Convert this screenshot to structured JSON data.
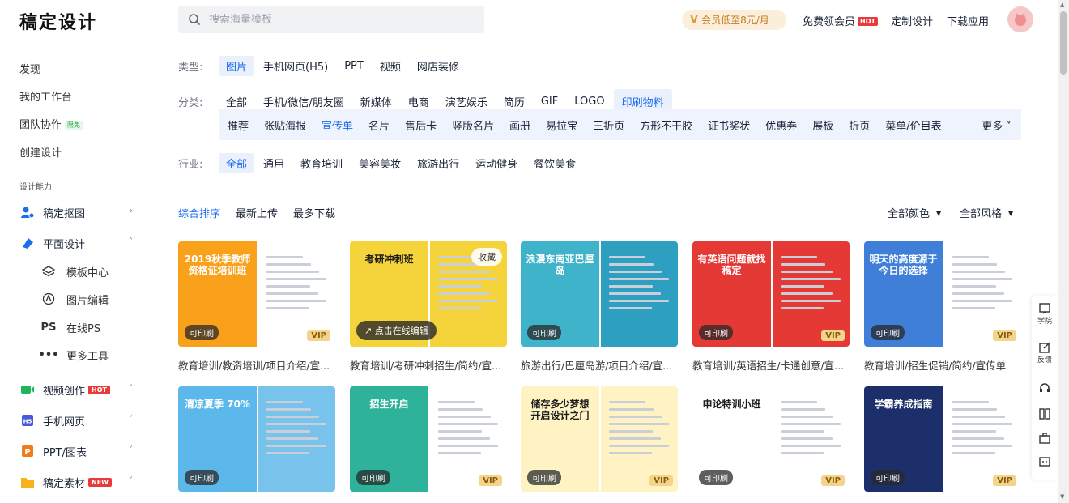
{
  "header": {
    "logo": "稿定设计",
    "search_placeholder": "搜索海量模板",
    "vip_promo": "会员低至8元/月",
    "free_vip": "免费领会员",
    "hot_badge": "HOT",
    "custom_design": "定制设计",
    "download_app": "下载应用"
  },
  "sidebar": {
    "top_items": [
      "发现",
      "我的工作台",
      "团队协作",
      "创建设计"
    ],
    "team_badge": "限免",
    "section_title": "设计能力",
    "ability_items": [
      {
        "label": "稿定抠图",
        "icon": "users-icon"
      },
      {
        "label": "平面设计",
        "icon": "paint-icon"
      }
    ],
    "sub_items": [
      {
        "label": "模板中心",
        "icon": "layers-icon"
      },
      {
        "label": "图片编辑",
        "icon": "pen-icon"
      },
      {
        "label": "在线PS",
        "icon": "ps-icon"
      },
      {
        "label": "更多工具",
        "icon": "more-icon"
      }
    ],
    "bottom_items": [
      {
        "label": "视频创作",
        "badge": "HOT"
      },
      {
        "label": "手机网页",
        "badge": ""
      },
      {
        "label": "PPT/图表",
        "badge": ""
      },
      {
        "label": "稿定素材",
        "badge": "NEW"
      }
    ]
  },
  "filters": {
    "type_label": "类型:",
    "types": [
      "图片",
      "手机网页(H5)",
      "PPT",
      "视频",
      "网店装修"
    ],
    "category_label": "分类:",
    "categories": [
      "全部",
      "手机/微信/朋友圈",
      "新媒体",
      "电商",
      "演艺娱乐",
      "简历",
      "GIF",
      "LOGO",
      "印刷物料"
    ],
    "subcategories": [
      "推荐",
      "张贴海报",
      "宣传单",
      "名片",
      "售后卡",
      "竖版名片",
      "画册",
      "易拉宝",
      "三折页",
      "方形不干胶",
      "证书奖状",
      "优惠券",
      "展板",
      "折页",
      "菜单/价目表"
    ],
    "more": "更多",
    "industry_label": "行业:",
    "industries": [
      "全部",
      "通用",
      "教育培训",
      "美容美妆",
      "旅游出行",
      "运动健身",
      "餐饮美食"
    ]
  },
  "sort": {
    "options": [
      "综合排序",
      "最新上传",
      "最多下载"
    ],
    "color_filter": "全部颜色",
    "style_filter": "全部风格"
  },
  "cards": [
    {
      "title": "教育培训/教资培训/项目介绍/宣...",
      "thumb_text": "2019秋季教师资格证培训班",
      "printable": "可印刷",
      "vip": "VIP",
      "left": "#f9a11b",
      "right": "#ffffff"
    },
    {
      "title": "教育培训/考研冲刺招生/简约/宣...",
      "thumb_text": "考研冲刺班",
      "printable": "可印刷",
      "vip": "",
      "left": "#f5d33a",
      "right": "#f5d33a",
      "hover_edit": "点击在线编辑",
      "hover_fav": "收藏"
    },
    {
      "title": "旅游出行/巴厘岛游/项目介绍/宣...",
      "thumb_text": "浪漫东南亚巴厘岛",
      "printable": "可印刷",
      "vip": "",
      "left": "#3fb3c9",
      "right": "#2d9fc0"
    },
    {
      "title": "教育培训/英语招生/卡通创意/宣...",
      "thumb_text": "有英语问题就找稿定",
      "printable": "可印刷",
      "vip": "VIP",
      "left": "#e53935",
      "right": "#e53935"
    },
    {
      "title": "教育培训/招生促销/简约/宣传单",
      "thumb_text": "明天的高度源于今日的选择",
      "printable": "可印刷",
      "vip": "VIP",
      "left": "#3f7fd8",
      "right": "#ffffff"
    },
    {
      "title": "",
      "thumb_text": "清凉夏季 70%",
      "printable": "可印刷",
      "vip": "",
      "left": "#5cb8ea",
      "right": "#78c3ec"
    },
    {
      "title": "",
      "thumb_text": "招生开启",
      "printable": "可印刷",
      "vip": "VIP",
      "left": "#2eb39a",
      "right": "#ffffff"
    },
    {
      "title": "",
      "thumb_text": "储存多少梦想 开启设计之门",
      "printable": "可印刷",
      "vip": "VIP",
      "left": "#fff3c4",
      "right": "#fff3c4"
    },
    {
      "title": "",
      "thumb_text": "申论特训小班",
      "printable": "可印刷",
      "vip": "VIP",
      "left": "#ffffff",
      "right": "#ffffff"
    },
    {
      "title": "",
      "thumb_text": "学霸养成指南",
      "printable": "可印刷",
      "vip": "VIP",
      "left": "#1c2f6b",
      "right": "#ffffff"
    }
  ],
  "float_bar": {
    "academy": "学院",
    "feedback": "反馈"
  },
  "colors": {
    "accent": "#1a6cf0",
    "hot": "#e83a3a"
  }
}
